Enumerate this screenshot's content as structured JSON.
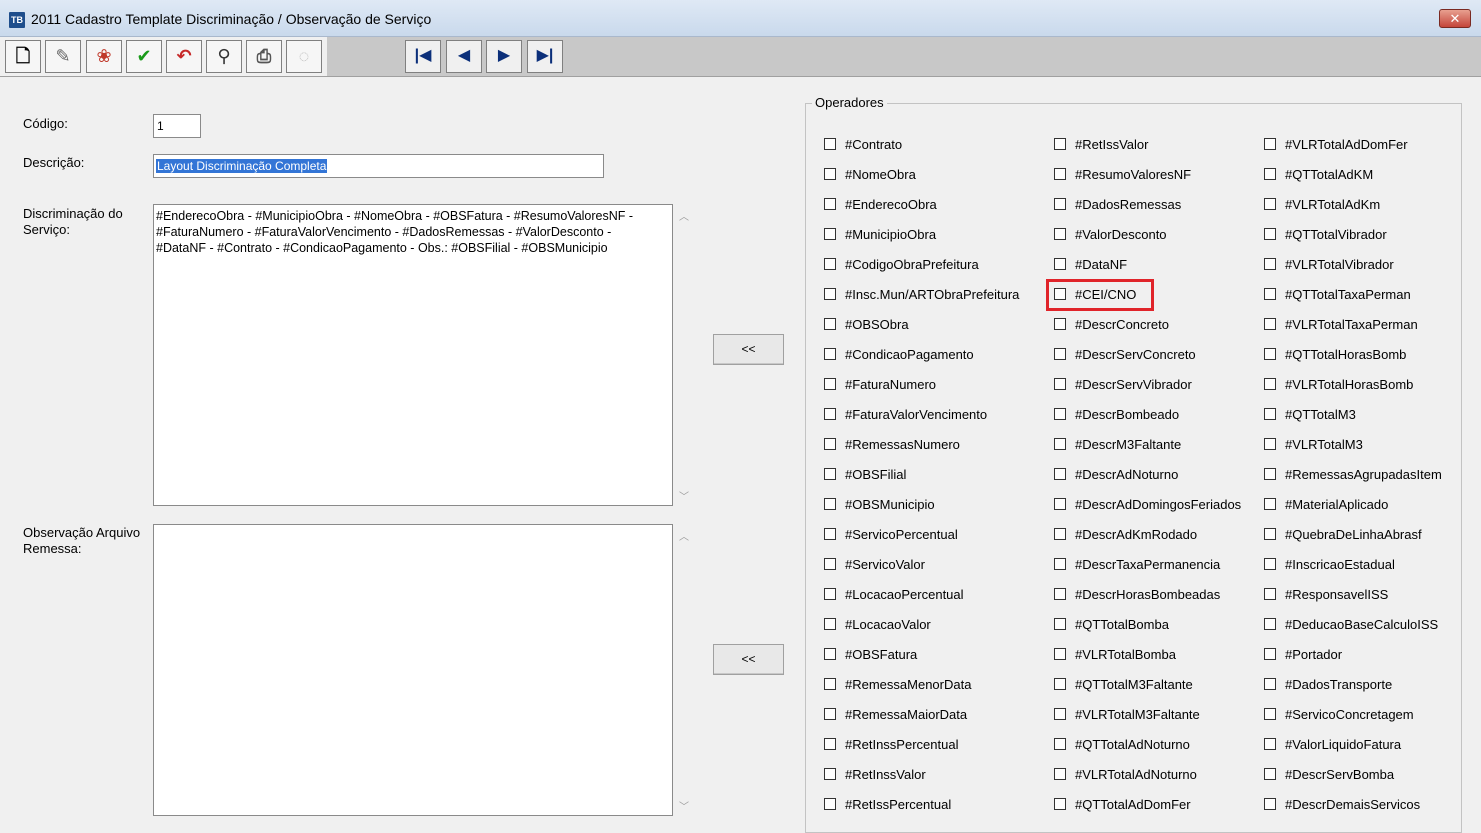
{
  "window": {
    "title": "2011 Cadastro Template Discriminação / Observação de Serviço",
    "app_icon": "TB",
    "close_label": "✕"
  },
  "toolbar": {
    "buttons": [
      {
        "name": "new-document-icon",
        "glyph": "🗋"
      },
      {
        "name": "edit-pencil-icon",
        "glyph": "✎"
      },
      {
        "name": "delete-icon",
        "glyph": "❀"
      },
      {
        "name": "confirm-check-icon",
        "glyph": "✔"
      },
      {
        "name": "undo-arrow-icon",
        "glyph": "↶"
      },
      {
        "name": "binoculars-search-icon",
        "glyph": "⚲"
      },
      {
        "name": "print-icon",
        "glyph": "⎙"
      },
      {
        "name": "disabled-tool-icon",
        "glyph": "◌"
      }
    ],
    "nav": [
      "|◀",
      "◀",
      "▶",
      "▶|"
    ]
  },
  "form": {
    "codigo_label": "Código:",
    "codigo_value": "1",
    "descricao_label": "Descrição:",
    "descricao_value": "Layout Discriminação Completa",
    "discriminacao_label_1": "Discriminação do",
    "discriminacao_label_2": "Serviço:",
    "discriminacao_lines": [
      "#EnderecoObra - #MunicipioObra - #NomeObra - #OBSFatura - #ResumoValoresNF -",
      "#FaturaNumero - #FaturaValorVencimento - #DadosRemessas - #ValorDesconto -",
      "#DataNF - #Contrato - #CondicaoPagamento - Obs.: #OBSFilial - #OBSMunicipio"
    ],
    "observacao_label_1": "Observação Arquivo",
    "observacao_label_2": "Remessa:",
    "observacao_value": "",
    "move_button_1": "<<",
    "move_button_2": "<<",
    "scroll_up": "︿",
    "scroll_down": "﹀"
  },
  "operadores": {
    "legend": "Operadores",
    "col1": [
      "#Contrato",
      "#NomeObra",
      "#EnderecoObra",
      "#MunicipioObra",
      "#CodigoObraPrefeitura",
      "#Insc.Mun/ARTObraPrefeitura",
      "#OBSObra",
      "#CondicaoPagamento",
      "#FaturaNumero",
      "#FaturaValorVencimento",
      "#RemessasNumero",
      "#OBSFilial",
      "#OBSMunicipio",
      "#ServicoPercentual",
      "#ServicoValor",
      "#LocacaoPercentual",
      "#LocacaoValor",
      "#OBSFatura",
      "#RemessaMenorData",
      "#RemessaMaiorData",
      "#RetInssPercentual",
      "#RetInssValor",
      "#RetIssPercentual"
    ],
    "col2": [
      "#RetIssValor",
      "#ResumoValoresNF",
      "#DadosRemessas",
      "#ValorDesconto",
      "#DataNF",
      "#CEI/CNO",
      "#DescrConcreto",
      "#DescrServConcreto",
      "#DescrServVibrador",
      "#DescrBombeado",
      "#DescrM3Faltante",
      "#DescrAdNoturno",
      "#DescrAdDomingosFeriados",
      "#DescrAdKmRodado",
      "#DescrTaxaPermanencia",
      "#DescrHorasBombeadas",
      "#QTTotalBomba",
      "#VLRTotalBomba",
      "#QTTotalM3Faltante",
      "#VLRTotalM3Faltante",
      "#QTTotalAdNoturno",
      "#VLRTotalAdNoturno",
      "#QTTotalAdDomFer"
    ],
    "col3": [
      "#VLRTotalAdDomFer",
      "#QTTotalAdKM",
      "#VLRTotalAdKm",
      "#QTTotalVibrador",
      "#VLRTotalVibrador",
      "#QTTotalTaxaPerman",
      "#VLRTotalTaxaPerman",
      "#QTTotalHorasBomb",
      "#VLRTotalHorasBomb",
      "#QTTotalM3",
      "#VLRTotalM3",
      "#RemessasAgrupadasItem",
      "#MaterialAplicado",
      "#QuebraDeLinhaAbrasf",
      "#InscricaoEstadual",
      "#ResponsavelISS",
      "#DeducaoBaseCalculoISS",
      "#Portador",
      "#DadosTransporte",
      "#ServicoConcretagem",
      "#ValorLiquidoFatura",
      "#DescrServBomba",
      "#DescrDemaisServicos"
    ]
  },
  "colors": {
    "highlight": "#e0242a",
    "selection": "#3375d6"
  }
}
